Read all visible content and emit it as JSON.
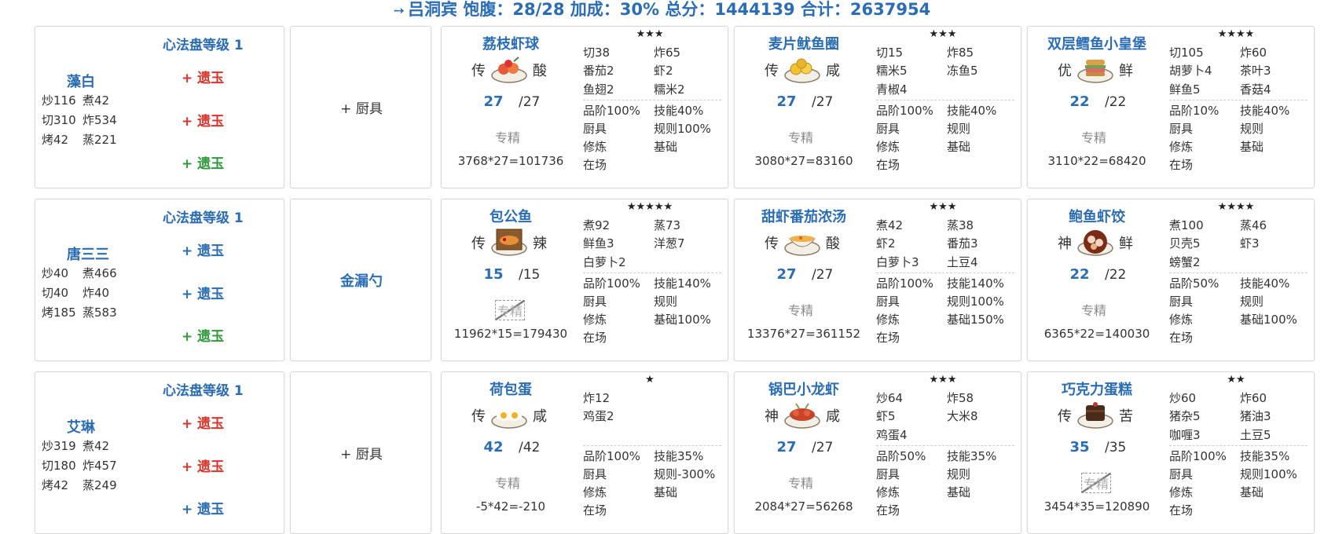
{
  "header": {
    "text": "吕洞宾 饱腹：28/28 加成：30% 总分：1444139 合计：2637954"
  },
  "rows": [
    {
      "chef": {
        "level": "心法盘等级 1",
        "name": "藻白",
        "skills": [
          [
            "炒116",
            "煮42"
          ],
          [
            "切310",
            "炸534"
          ],
          [
            "烤42",
            "蒸221"
          ]
        ],
        "jades": [
          {
            "label": "+ 遗玉",
            "color": "red"
          },
          {
            "label": "+ 遗玉",
            "color": "red"
          },
          {
            "label": "+ 遗玉",
            "color": "green"
          }
        ]
      },
      "tool": {
        "label": "+ 厨具",
        "equipped": false
      },
      "dishes": [
        {
          "name": "荔枝虾球",
          "rank": "传",
          "taste": "酸",
          "icon": "shrimp-ball-icon",
          "qty": "27",
          "qmax": "/27",
          "spec": "专精",
          "spec_off": false,
          "calc": "3768*27=101736",
          "stars": "★★★",
          "ingredients": [
            "切38",
            "炸65",
            "番茄2",
            "虾2",
            "鱼翅2",
            "糯米2"
          ],
          "bonus": [
            "品阶100%",
            "技能40%",
            "厨具",
            "规则100%",
            "修炼",
            "基础",
            "在场",
            ""
          ]
        },
        {
          "name": "麦片鱿鱼圈",
          "rank": "传",
          "taste": "咸",
          "icon": "squid-ring-icon",
          "qty": "27",
          "qmax": "/27",
          "spec": "专精",
          "spec_off": false,
          "calc": "3080*27=83160",
          "stars": "★★★",
          "ingredients": [
            "切15",
            "炸85",
            "糯米5",
            "冻鱼5",
            "青椒4",
            ""
          ],
          "bonus": [
            "品阶100%",
            "技能40%",
            "厨具",
            "规则",
            "修炼",
            "基础",
            "在场",
            ""
          ]
        },
        {
          "name": "双层鳕鱼小皇堡",
          "rank": "优",
          "taste": "鲜",
          "icon": "burger-icon",
          "qty": "22",
          "qmax": "/22",
          "spec": "专精",
          "spec_off": false,
          "calc": "3110*22=68420",
          "stars": "★★★★",
          "ingredients": [
            "切105",
            "炸60",
            "胡萝卜4",
            "茶叶3",
            "鲜鱼5",
            "香菇4"
          ],
          "bonus": [
            "品阶10%",
            "技能40%",
            "厨具",
            "规则",
            "修炼",
            "基础",
            "在场",
            ""
          ]
        }
      ]
    },
    {
      "chef": {
        "level": "心法盘等级 1",
        "name": "唐三三",
        "skills": [
          [
            "炒40",
            "煮466"
          ],
          [
            "切40",
            "炸40"
          ],
          [
            "烤185",
            "蒸583"
          ]
        ],
        "jades": [
          {
            "label": "+ 遗玉",
            "color": "blue"
          },
          {
            "label": "+ 遗玉",
            "color": "blue"
          },
          {
            "label": "+ 遗玉",
            "color": "green"
          }
        ]
      },
      "tool": {
        "label": "金漏勺",
        "equipped": true
      },
      "dishes": [
        {
          "name": "包公鱼",
          "rank": "传",
          "taste": "辣",
          "icon": "fish-box-icon",
          "qty": "15",
          "qmax": "/15",
          "spec": "专精",
          "spec_off": true,
          "calc": "11962*15=179430",
          "stars": "★★★★★",
          "ingredients": [
            "煮92",
            "蒸73",
            "鲜鱼3",
            "洋葱7",
            "白萝卜2",
            ""
          ],
          "bonus": [
            "品阶100%",
            "技能140%",
            "厨具",
            "规则",
            "修炼",
            "基础100%",
            "在场",
            ""
          ]
        },
        {
          "name": "甜虾番茄浓汤",
          "rank": "传",
          "taste": "酸",
          "icon": "soup-bowl-icon",
          "qty": "27",
          "qmax": "/27",
          "spec": "专精",
          "spec_off": false,
          "calc": "13376*27=361152",
          "stars": "★★★",
          "ingredients": [
            "煮42",
            "蒸38",
            "虾2",
            "番茄3",
            "白萝卜3",
            "土豆4"
          ],
          "bonus": [
            "品阶100%",
            "技能140%",
            "厨具",
            "规则100%",
            "修炼",
            "基础150%",
            "在场",
            ""
          ]
        },
        {
          "name": "鲍鱼虾饺",
          "rank": "神",
          "taste": "鲜",
          "icon": "dumpling-icon",
          "qty": "22",
          "qmax": "/22",
          "spec": "专精",
          "spec_off": false,
          "calc": "6365*22=140030",
          "stars": "★★★★",
          "ingredients": [
            "煮100",
            "蒸46",
            "贝壳5",
            "虾3",
            "螃蟹2",
            ""
          ],
          "bonus": [
            "品阶50%",
            "技能40%",
            "厨具",
            "规则",
            "修炼",
            "基础100%",
            "在场",
            ""
          ]
        }
      ]
    },
    {
      "chef": {
        "level": "心法盘等级 1",
        "name": "艾琳",
        "skills": [
          [
            "炒319",
            "煮42"
          ],
          [
            "切180",
            "炸457"
          ],
          [
            "烤42",
            "蒸249"
          ]
        ],
        "jades": [
          {
            "label": "+ 遗玉",
            "color": "red"
          },
          {
            "label": "+ 遗玉",
            "color": "red"
          },
          {
            "label": "+ 遗玉",
            "color": "blue"
          }
        ]
      },
      "tool": {
        "label": "+ 厨具",
        "equipped": false
      },
      "dishes": [
        {
          "name": "荷包蛋",
          "rank": "传",
          "taste": "咸",
          "icon": "fried-egg-icon",
          "qty": "42",
          "qmax": "/42",
          "spec": "专精",
          "spec_off": false,
          "calc": "-5*42=-210",
          "stars": "★",
          "ingredients": [
            "炸12",
            "",
            "鸡蛋2",
            "",
            "",
            ""
          ],
          "bonus": [
            "品阶100%",
            "技能35%",
            "厨具",
            "规则-300%",
            "修炼",
            "基础",
            "在场",
            ""
          ]
        },
        {
          "name": "锅巴小龙虾",
          "rank": "神",
          "taste": "咸",
          "icon": "crayfish-icon",
          "qty": "27",
          "qmax": "/27",
          "spec": "专精",
          "spec_off": false,
          "calc": "2084*27=56268",
          "stars": "★★★",
          "ingredients": [
            "炒64",
            "炸58",
            "虾5",
            "大米8",
            "鸡蛋4",
            ""
          ],
          "bonus": [
            "品阶50%",
            "技能35%",
            "厨具",
            "规则",
            "修炼",
            "基础",
            "在场",
            ""
          ]
        },
        {
          "name": "巧克力蛋糕",
          "rank": "传",
          "taste": "苦",
          "icon": "chocolate-cake-icon",
          "qty": "35",
          "qmax": "/35",
          "spec": "专精",
          "spec_off": true,
          "calc": "3454*35=120890",
          "stars": "★★",
          "ingredients": [
            "炒60",
            "炸60",
            "猪杂5",
            "猪油3",
            "咖喱3",
            "土豆5"
          ],
          "bonus": [
            "品阶100%",
            "技能35%",
            "厨具",
            "规则100%",
            "修炼",
            "基础",
            "在场",
            ""
          ]
        }
      ]
    }
  ]
}
